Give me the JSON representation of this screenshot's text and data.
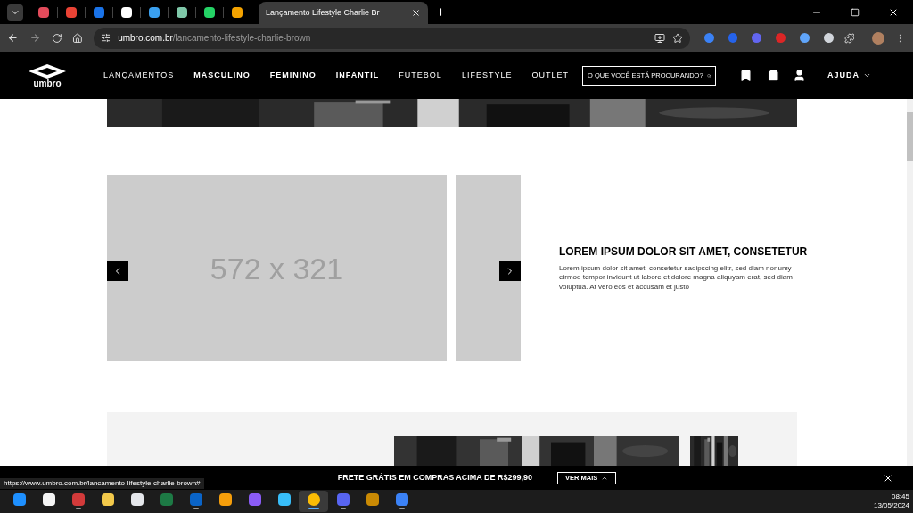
{
  "browser": {
    "tab": {
      "title": "Lançamento Lifestyle Charlie Br"
    },
    "address": {
      "domain": "umbro.com.br",
      "path": "/lancamento-lifestyle-charlie-brown"
    }
  },
  "site": {
    "logo": "umbro",
    "nav": [
      {
        "label": "LANÇAMENTOS",
        "bold": false
      },
      {
        "label": "MASCULINO",
        "bold": true
      },
      {
        "label": "FEMININO",
        "bold": true
      },
      {
        "label": "INFANTIL",
        "bold": true
      },
      {
        "label": "FUTEBOL",
        "bold": false
      },
      {
        "label": "LIFESTYLE",
        "bold": false
      },
      {
        "label": "OUTLET",
        "bold": false
      }
    ],
    "search": {
      "placeholder": "O QUE VOCÊ ESTÁ PROCURANDO?"
    },
    "help": "AJUDA"
  },
  "carousel": {
    "placeholder": "572 x 321"
  },
  "feature": {
    "title": "LOREM IPSUM DOLOR SIT AMET, CONSETETUR",
    "body": "Lorem ipsum dolor sit amet, consetetur sadipscing elitr, sed diam nonumy eirmod tempor invidunt ut labore et dolore magna aliquyam erat, sed diam voluptua. At vero eos et accusam et justo"
  },
  "promo": {
    "text": "FRETE GRÁTIS EM COMPRAS ACIMA DE R$299,90",
    "button": "VER MAIS"
  },
  "status_url": "https://www.umbro.com.br/lancamento-lifestyle-charlie-brown#",
  "taskbar": {
    "time": "08:45",
    "date": "13/05/2024",
    "apps": [
      {
        "selected": false,
        "running": false
      },
      {
        "selected": false,
        "running": false
      },
      {
        "selected": false,
        "running": true
      },
      {
        "selected": false,
        "running": false
      },
      {
        "selected": false,
        "running": false
      },
      {
        "selected": false,
        "running": false
      },
      {
        "selected": false,
        "running": true
      },
      {
        "selected": false,
        "running": false
      },
      {
        "selected": false,
        "running": false
      },
      {
        "selected": false,
        "running": false
      },
      {
        "selected": true,
        "running": true
      },
      {
        "selected": false,
        "running": true
      },
      {
        "selected": false,
        "running": false
      },
      {
        "selected": false,
        "running": true
      }
    ]
  }
}
